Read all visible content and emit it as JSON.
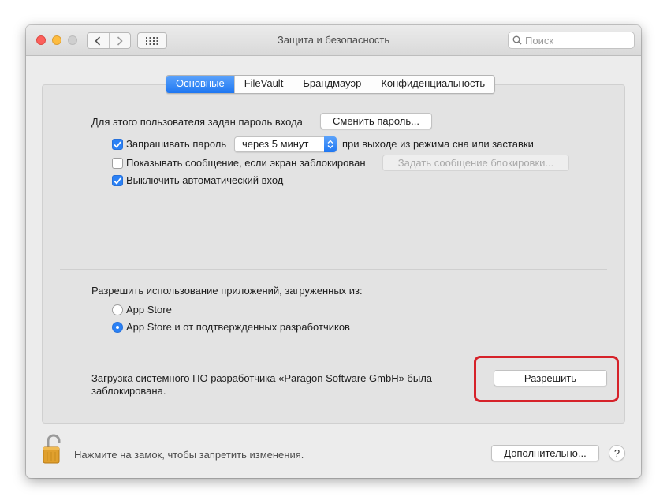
{
  "window": {
    "title": "Защита и безопасность",
    "search_placeholder": "Поиск"
  },
  "tabs": [
    {
      "label": "Основные",
      "active": true
    },
    {
      "label": "FileVault",
      "active": false
    },
    {
      "label": "Брандмауэр",
      "active": false
    },
    {
      "label": "Конфиденциальность",
      "active": false
    }
  ],
  "general": {
    "password_label": "Для этого пользователя задан пароль входа",
    "change_password_button": "Сменить пароль...",
    "require_password": {
      "checked": true,
      "label": "Запрашивать пароль",
      "delay_value": "через 5 минут",
      "suffix": "при выходе из режима сна или заставки"
    },
    "show_message": {
      "checked": false,
      "label": "Показывать сообщение, если экран заблокирован",
      "button": "Задать сообщение блокировки..."
    },
    "disable_autologin": {
      "checked": true,
      "label": "Выключить автоматический вход"
    }
  },
  "apps": {
    "heading": "Разрешить использование приложений, загруженных из:",
    "options": [
      {
        "label": "App Store",
        "selected": false
      },
      {
        "label": "App Store и от подтвержденных разработчиков",
        "selected": true
      }
    ]
  },
  "blocked": {
    "line1": "Загрузка системного ПО разработчика «Paragon Software GmbH» была",
    "line2": "заблокирована.",
    "allow_button": "Разрешить"
  },
  "footer": {
    "lock_text": "Нажмите на замок, чтобы запретить изменения.",
    "advanced_button": "Дополнительно...",
    "help_label": "?"
  },
  "colors": {
    "accent": "#1f77f2",
    "highlight": "#d6222a"
  }
}
